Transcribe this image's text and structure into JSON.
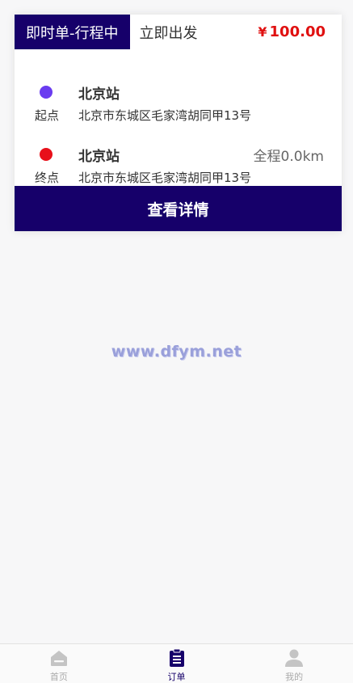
{
  "order_card": {
    "status_tag": "即时单-行程中",
    "order_type": "立即出发",
    "price_symbol": "¥",
    "price_value": "100.00",
    "start": {
      "tag": "起点",
      "name": "北京站",
      "address": "北京市东城区毛家湾胡同甲13号"
    },
    "end": {
      "tag": "终点",
      "name": "北京站",
      "address": "北京市东城区毛家湾胡同甲13号",
      "distance": "全程0.0km"
    },
    "detail_button_label": "查看详情"
  },
  "watermark": "www.dfym.net",
  "tab_bar": {
    "items": [
      {
        "label": "首页",
        "icon": "home-icon",
        "active": false
      },
      {
        "label": "订单",
        "icon": "order-list-icon",
        "active": true
      },
      {
        "label": "我的",
        "icon": "user-icon",
        "active": false
      }
    ]
  },
  "colors": {
    "brand": "#16006a",
    "price": "#e01010",
    "start_dot": "#6a3cf0",
    "end_dot": "#e8101a",
    "background": "#f7f7f8"
  }
}
